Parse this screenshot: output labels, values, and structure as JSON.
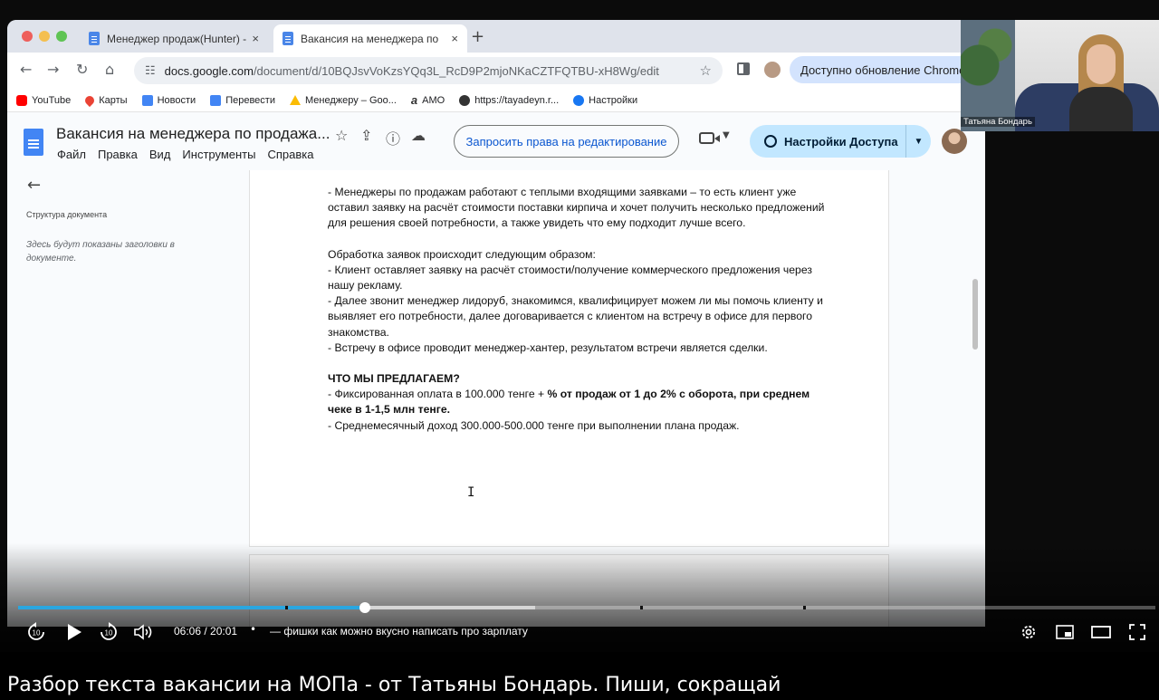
{
  "browser": {
    "tabs": [
      {
        "label": "Менеджер продаж(Hunter) -",
        "close": "×"
      },
      {
        "label": "Вакансия на менеджера по",
        "close": "×"
      }
    ],
    "new_tab": "+",
    "url_host": "docs.google.com",
    "url_path": "/document/d/10BQJsvVoKzsYQq3L_RcD9P2mjoNKaCZTFQTBU-xH8Wg/edit",
    "update_label": "Доступно обновление Chrome",
    "bookmarks": [
      {
        "label": "YouTube",
        "icon": "youtube-icon"
      },
      {
        "label": "Карты",
        "icon": "maps-pin-icon"
      },
      {
        "label": "Новости",
        "icon": "news-icon"
      },
      {
        "label": "Перевести",
        "icon": "translate-icon"
      },
      {
        "label": "Менеджеру – Goo...",
        "icon": "drive-icon"
      },
      {
        "label": "AMO",
        "icon": "amo-icon"
      },
      {
        "label": "https://tayadeyn.r...",
        "icon": "site-icon"
      },
      {
        "label": "Настройки",
        "icon": "facebook-icon"
      }
    ]
  },
  "docs": {
    "title": "Вакансия на менеджера по продажа...",
    "menu": [
      "Файл",
      "Правка",
      "Вид",
      "Инструменты",
      "Справка"
    ],
    "request_edit_label": "Запросить права на редактирование",
    "share_label": "Настройки Доступа",
    "outline_title": "Структура документа",
    "outline_hint": "Здесь будут показаны заголовки в документе.",
    "paragraphs": {
      "p1": "- Менеджеры по продажам работают с теплыми входящими заявками – то есть клиент уже оставил заявку на расчёт стоимости поставки кирпича и хочет получить несколько предложений для решения своей потребности, а также увидеть что ему подходит лучше всего.",
      "p2": "Обработка заявок происходит следующим образом:",
      "p3": "- Клиент оставляет заявку на расчёт стоимости/получение коммерческого предложения через нашу рекламу.",
      "p4": "- Далее звонит менеджер лидоруб, знакомимся, квалифицирует можем ли мы помочь клиенту и выявляет его потребности, далее договаривается с клиентом на встречу в офисе для первого знакомства.",
      "p5": "- Встречу в офисе проводит менеджер-хантер, результатом встречи является сделки.",
      "heading": "ЧТО МЫ ПРЕДЛАГАЕМ?",
      "p6_normal": "- Фиксированная оплата в 100.000 тенге + ",
      "p6_bold": "% от продаж от 1 до 2% с оборота, при среднем чеке в 1-1,5 млн тенге.",
      "p7": "- Среднемесячный доход 300.000-500.000 тенге при выполнении плана продаж."
    }
  },
  "webcam": {
    "name": "Татьяна Бондарь"
  },
  "player": {
    "current_time": "06:06",
    "duration": "20:01",
    "separator": "•",
    "chapter": "— фишки как можно вкусно написать про зарплату",
    "progress_fraction": 0.305,
    "buffered_fraction": 0.455,
    "chapter_marks": [
      0.235,
      0.547,
      0.69,
      0.69
    ],
    "accent_color": "#2aa6e0"
  },
  "video_title": "Разбор текста вакансии на МОПа - от Татьяны Бондарь. Пиши, сокращай"
}
